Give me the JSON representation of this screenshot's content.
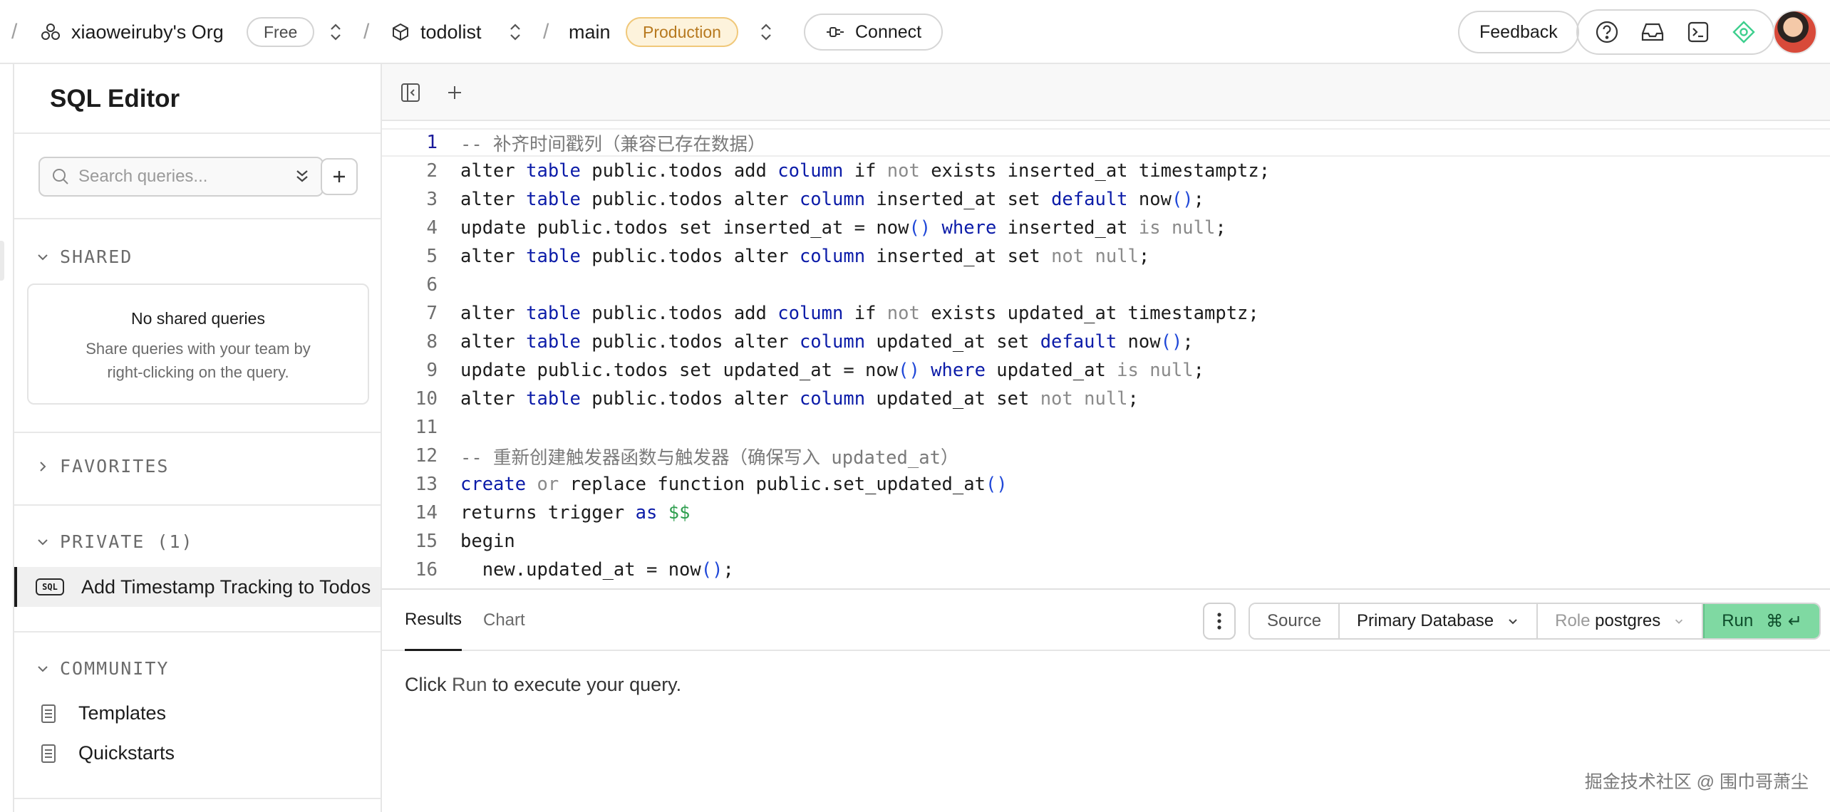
{
  "topbar": {
    "org_name": "xiaoweiruby's Org",
    "plan_badge": "Free",
    "project_name": "todolist",
    "branch_name": "main",
    "env_badge": "Production",
    "connect_label": "Connect",
    "feedback_label": "Feedback"
  },
  "sidebar": {
    "title": "SQL Editor",
    "search_placeholder": "Search queries...",
    "shared": {
      "label": "SHARED",
      "empty_title": "No shared queries",
      "empty_line1": "Share queries with your team by",
      "empty_line2": "right-clicking on the query."
    },
    "favorites_label": "FAVORITES",
    "private_label": "PRIVATE (1)",
    "private_items": [
      {
        "badge": "SQL",
        "label": "Add Timestamp Tracking to Todos"
      }
    ],
    "community_label": "COMMUNITY",
    "community_items": [
      {
        "label": "Templates"
      },
      {
        "label": "Quickstarts"
      }
    ]
  },
  "editor": {
    "active_line": 1,
    "lines": [
      {
        "n": "1"
      },
      {
        "n": "2"
      },
      {
        "n": "3"
      },
      {
        "n": "4"
      },
      {
        "n": "5"
      },
      {
        "n": "6"
      },
      {
        "n": "7"
      },
      {
        "n": "8"
      },
      {
        "n": "9"
      },
      {
        "n": "10"
      },
      {
        "n": "11"
      },
      {
        "n": "12"
      },
      {
        "n": "13"
      },
      {
        "n": "14"
      },
      {
        "n": "15"
      },
      {
        "n": "16"
      }
    ]
  },
  "results": {
    "tab_results": "Results",
    "tab_chart": "Chart",
    "source_label": "Source",
    "database_label": "Primary Database",
    "role_prefix": "Role",
    "role_value": "postgres",
    "run_label": "Run",
    "run_shortcut": "⌘ ↵",
    "message_prefix": "Click ",
    "message_run": "Run",
    "message_suffix": " to execute your query."
  },
  "watermark": "掘金技术社区 @ 围巾哥萧尘"
}
